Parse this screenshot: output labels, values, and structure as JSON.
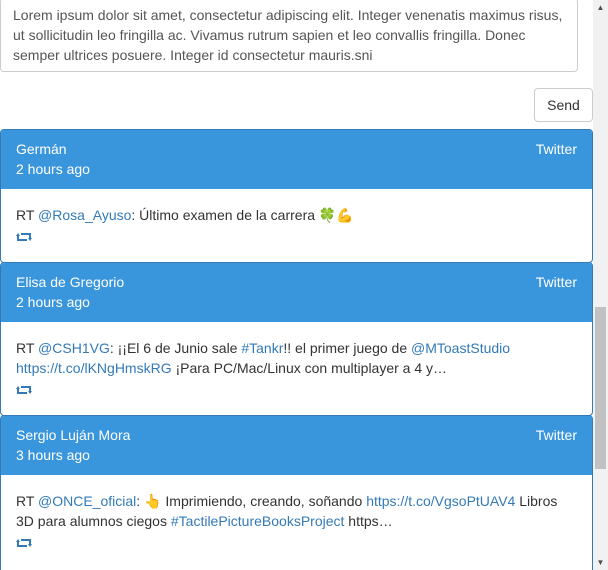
{
  "composer": {
    "text": "Lorem ipsum dolor sit amet, consectetur adipiscing elit. Integer venenatis maximus risus, ut sollicitudin leo fringilla ac. Vivamus rutrum sapien et leo convallis fringilla. Donec semper ultrices posuere. Integer id consectetur mauris.sni"
  },
  "send_label": "Send",
  "accent": "#3a96dc",
  "link_color": "#337ab7",
  "posts": [
    {
      "author": "Germán",
      "time": "2 hours ago",
      "source": "Twitter",
      "segments": [
        {
          "t": "RT "
        },
        {
          "t": "@Rosa_Ayuso",
          "link": true
        },
        {
          "t": ": Último examen de la carrera 🍀💪"
        }
      ],
      "icon": "retweet-icon"
    },
    {
      "author": "Elisa de Gregorio",
      "time": "2 hours ago",
      "source": "Twitter",
      "segments": [
        {
          "t": "RT "
        },
        {
          "t": "@CSH1VG",
          "link": true
        },
        {
          "t": ": ¡¡El 6 de Junio sale "
        },
        {
          "t": "#Tankr",
          "link": true
        },
        {
          "t": "!! el primer juego de "
        },
        {
          "t": "@MToastStudio",
          "link": true
        },
        {
          "t": " "
        },
        {
          "t": "https://t.co/lKNgHmskRG",
          "link": true
        },
        {
          "t": " ¡Para PC/Mac/Linux con multiplayer a 4 y…"
        }
      ],
      "icon": "retweet-icon"
    },
    {
      "author": "Sergio Luján Mora",
      "time": "3 hours ago",
      "source": "Twitter",
      "segments": [
        {
          "t": "RT "
        },
        {
          "t": "@ONCE_oficial",
          "link": true
        },
        {
          "t": ": 👆 Imprimiendo, creando, soñando "
        },
        {
          "t": "https://t.co/VgsoPtUAV4",
          "link": true
        },
        {
          "t": " Libros 3D para alumnos ciegos "
        },
        {
          "t": "#TactilePictureBooksProject",
          "link": true
        },
        {
          "t": " https…"
        }
      ],
      "icon": "retweet-icon"
    }
  ]
}
